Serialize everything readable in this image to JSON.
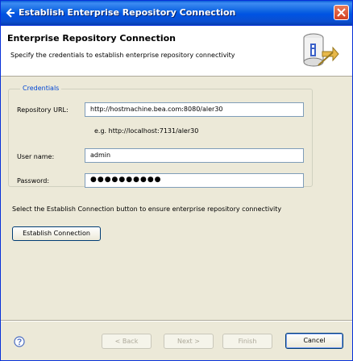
{
  "window": {
    "title": "Establish Enterprise Repository Connection"
  },
  "banner": {
    "title": "Enterprise Repository Connection",
    "description": "Specify the credentials to establish enterprise repository connectivity"
  },
  "credentials": {
    "group_label": "Credentials",
    "repository_url_label": "Repository URL:",
    "repository_url_value": "http://hostmachine.bea.com:8080/aler30",
    "example_text": "e.g. http://localhost:7131/aler30",
    "username_label": "User name:",
    "username_value": "admin",
    "password_label": "Password:",
    "password_value": "●●●●●●●●●●"
  },
  "info_text": "Select the Establish Connection button to ensure enterprise repository connectivity",
  "establish_button_label": "Establish Connection",
  "footer": {
    "back_label": "< Back",
    "next_label": "Next >",
    "finish_label": "Finish",
    "cancel_label": "Cancel"
  },
  "colors": {
    "titlebar": "#0054e3",
    "dialog_bg": "#ece9d8",
    "group_label": "#0046d5"
  },
  "icons": [
    "window-icon",
    "close-icon",
    "repository-database-icon",
    "help-icon"
  ]
}
